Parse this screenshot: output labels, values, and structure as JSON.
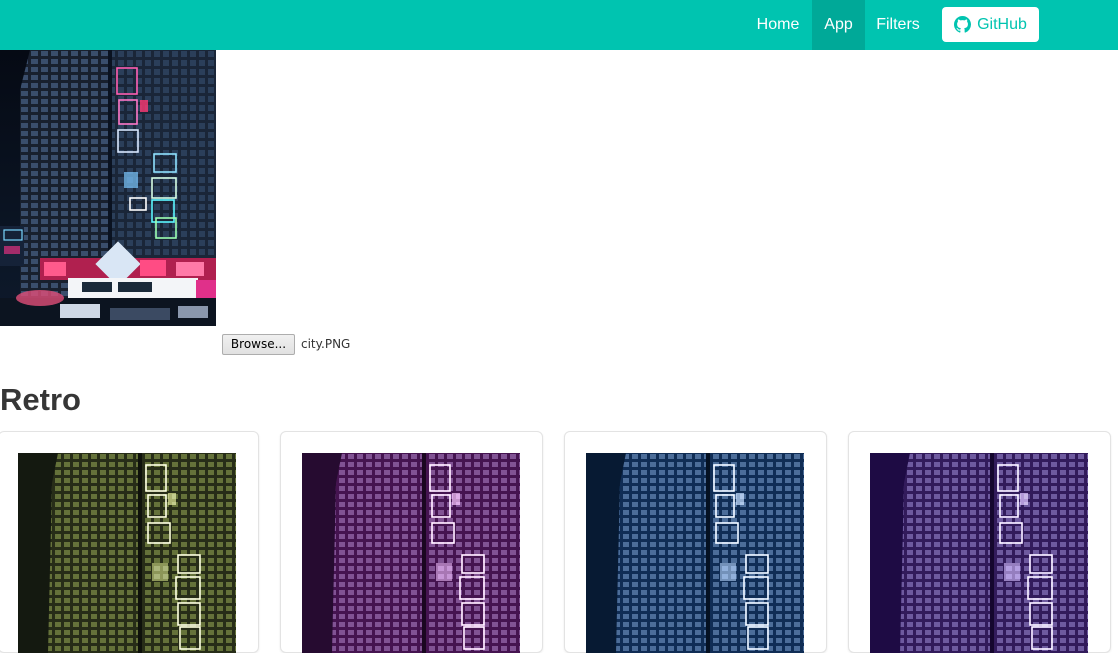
{
  "navbar": {
    "items": [
      {
        "label": "Home"
      },
      {
        "label": "App",
        "active": true
      },
      {
        "label": "Filters"
      }
    ],
    "github_label": "GitHub",
    "github_icon": "github-icon",
    "accent_color": "#00c4b0",
    "active_color": "#00a998"
  },
  "upload": {
    "browse_label": "Browse...",
    "file_name": "city.PNG"
  },
  "section": {
    "title": "Retro"
  },
  "filters": [
    {
      "tint": "#6f7a00",
      "tint_name": "olive"
    },
    {
      "tint": "#6a0a6e",
      "tint_name": "purple"
    },
    {
      "tint": "#0b3a78",
      "tint_name": "blue"
    },
    {
      "tint": "#5a2a95",
      "tint_name": "violet"
    }
  ]
}
